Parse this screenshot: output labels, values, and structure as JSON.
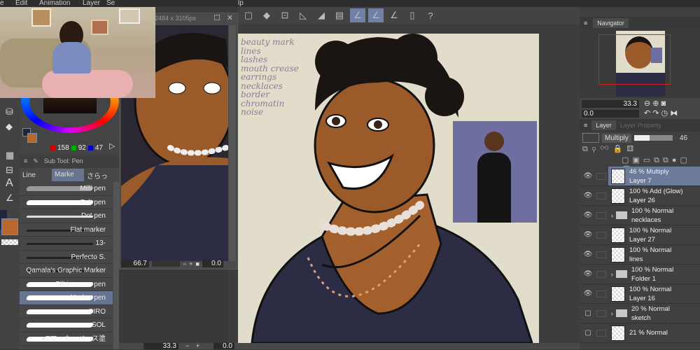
{
  "menu": [
    "e",
    "Edit",
    "Animation",
    "Layer",
    "Se"
  ],
  "menu_right": "lp",
  "subview": {
    "title": "2484 x 3105px",
    "zoom": "66.7",
    "angle": "0.0"
  },
  "status": {
    "zoom": "33.3",
    "angle": "0.0"
  },
  "color": {
    "r": "158",
    "g": "92",
    "b": "47",
    "main": "#b8682e",
    "sub": "#23263a"
  },
  "subtool": {
    "title": "Sub Tool: Pen",
    "tabs": [
      "Line",
      "Marke",
      "さらっ"
    ],
    "brushes": [
      "Milli pen",
      "Felt pen",
      "Dot pen",
      "Flat marker",
      "13-",
      "Perfecto S.",
      "Qamala's Graphic Marker",
      "Fill-in-mono pen",
      "Marker pen",
      "CIRO",
      "SOL",
      "■Tマーカーベース塗"
    ],
    "selected": 8
  },
  "checklist": [
    "beauty mark",
    "lines",
    "lashes",
    "mouth crease",
    "earrings",
    "necklaces",
    "border",
    "chromatin",
    "noise"
  ],
  "navigator": {
    "title": "Navigator",
    "zoom": "33.3",
    "angle": "0.0"
  },
  "layer_panel": {
    "tabs": [
      "Layer",
      "Layer Property"
    ],
    "blend": "Multiply",
    "opacity": "46",
    "layers": [
      {
        "mode": "46 % Multiply",
        "name": "Layer 7",
        "type": "layer",
        "selected": true
      },
      {
        "mode": "100 % Add (Glow)",
        "name": "Layer 26",
        "type": "layer"
      },
      {
        "mode": "100 % Normal",
        "name": "necklaces",
        "type": "folder"
      },
      {
        "mode": "100 % Normal",
        "name": "Layer 27",
        "type": "layer"
      },
      {
        "mode": "100 % Normal",
        "name": "lines",
        "type": "layer"
      },
      {
        "mode": "100 % Normal",
        "name": "Folder 1",
        "type": "folder"
      },
      {
        "mode": "100 % Normal",
        "name": "Layer 16",
        "type": "layer"
      },
      {
        "mode": "20 % Normal",
        "name": "sketch",
        "type": "folder",
        "hidden": true
      },
      {
        "mode": "21 % Normal",
        "name": "",
        "type": "layer",
        "hidden": true
      }
    ]
  }
}
